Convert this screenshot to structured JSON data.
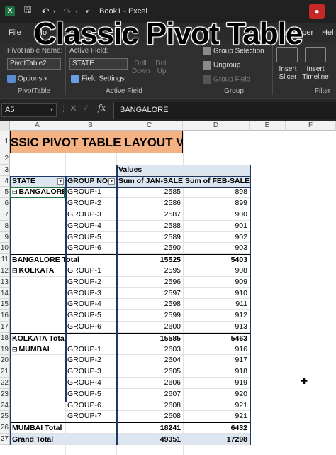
{
  "app": {
    "title": "Book1 - Excel",
    "logo_letter": "X"
  },
  "overlay_title": "Classic Pivot Table",
  "tabs": [
    "File",
    "Ho",
    "ata",
    "Developer",
    "Hel"
  ],
  "ribbon": {
    "pivottable_name_label": "PivotTable Name:",
    "pivottable_name_value": "PivotTable2",
    "options_label": "Options",
    "pivottable_group_label": "PivotTable",
    "active_field_label": "Active Field:",
    "active_field_value": "STATE",
    "field_settings_label": "Field Settings",
    "active_field_group_label": "Active Field",
    "drill_down_label": "Drill Down",
    "drill_up_label": "Drill Up",
    "group_selection_label": "Group Selection",
    "ungroup_label": "Ungroup",
    "group_field_label": "Group Field",
    "group_group_label": "Group",
    "insert_slicer_label": "Insert Slicer",
    "insert_timeline_label": "Insert Timeline",
    "filter_group_label": "Filter"
  },
  "formula_bar": {
    "name_box": "A5",
    "fx": "fx",
    "value": "BANGALORE"
  },
  "columns": [
    "A",
    "B",
    "C",
    "D",
    "E",
    "F"
  ],
  "rows": [
    "1",
    "2",
    "3",
    "4",
    "5",
    "6",
    "7",
    "8",
    "9",
    "10",
    "11",
    "12",
    "13",
    "14",
    "15",
    "16",
    "17",
    "18",
    "19",
    "20",
    "21",
    "22",
    "23",
    "24",
    "25",
    "26",
    "27"
  ],
  "banner_text": "SSIC PIVOT TABLE LAYOUT V",
  "pivot": {
    "values_header": "Values",
    "headers": [
      "STATE",
      "GROUP NO",
      "Sum of JAN-SALES",
      "Sum of FEB-SALES"
    ],
    "states": [
      {
        "name": "BANGALORE",
        "rows": [
          [
            "GROUP-1",
            "2585",
            "898"
          ],
          [
            "GROUP-2",
            "2586",
            "899"
          ],
          [
            "GROUP-3",
            "2587",
            "900"
          ],
          [
            "GROUP-4",
            "2588",
            "901"
          ],
          [
            "GROUP-5",
            "2589",
            "902"
          ],
          [
            "GROUP-6",
            "2590",
            "903"
          ]
        ],
        "total_label": "BANGALORE Total",
        "total": [
          "15525",
          "5403"
        ]
      },
      {
        "name": "KOLKATA",
        "rows": [
          [
            "GROUP-1",
            "2595",
            "908"
          ],
          [
            "GROUP-2",
            "2596",
            "909"
          ],
          [
            "GROUP-3",
            "2597",
            "910"
          ],
          [
            "GROUP-4",
            "2598",
            "911"
          ],
          [
            "GROUP-5",
            "2599",
            "912"
          ],
          [
            "GROUP-6",
            "2600",
            "913"
          ]
        ],
        "total_label": "KOLKATA Total",
        "total": [
          "15585",
          "5463"
        ]
      },
      {
        "name": "MUMBAI",
        "rows": [
          [
            "GROUP-1",
            "2603",
            "916"
          ],
          [
            "GROUP-2",
            "2604",
            "917"
          ],
          [
            "GROUP-3",
            "2605",
            "918"
          ],
          [
            "GROUP-4",
            "2606",
            "919"
          ],
          [
            "GROUP-5",
            "2607",
            "920"
          ],
          [
            "GROUP-6",
            "2608",
            "921"
          ],
          [
            "GROUP-7",
            "2608",
            "921"
          ]
        ],
        "total_label": "MUMBAI Total",
        "total": [
          "18241",
          "6432"
        ]
      }
    ],
    "grand_total_label": "Grand Total",
    "grand_total": [
      "49351",
      "17298"
    ]
  },
  "colors": {
    "excel_green": "#1d6f42",
    "banner_fill": "#f4b183",
    "pivot_header_fill": "#dce6f1",
    "pivot_border": "#1f3864"
  }
}
